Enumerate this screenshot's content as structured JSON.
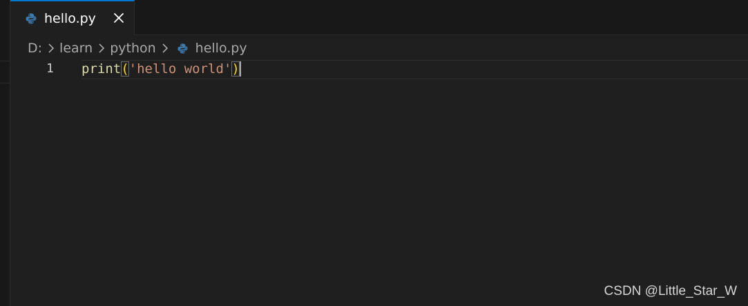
{
  "tabs": [
    {
      "label": "hello.py",
      "icon": "python-file-icon",
      "active": true
    }
  ],
  "breadcrumb": {
    "items": [
      "D:",
      "learn",
      "python",
      "hello.py"
    ]
  },
  "editor": {
    "line_numbers": [
      "1"
    ],
    "line1": {
      "func": "print",
      "open_paren": "(",
      "string": "'hello world'",
      "close_paren": ")"
    }
  },
  "watermark": "CSDN @Little_Star_W",
  "colors": {
    "accent": "#0078d4",
    "background": "#1f1f1f",
    "func": "#dcdcaa",
    "string": "#ce9178",
    "bracket": "#ffd700",
    "python_blue": "#3e7ab0",
    "python_yellow": "#f2d04c"
  }
}
